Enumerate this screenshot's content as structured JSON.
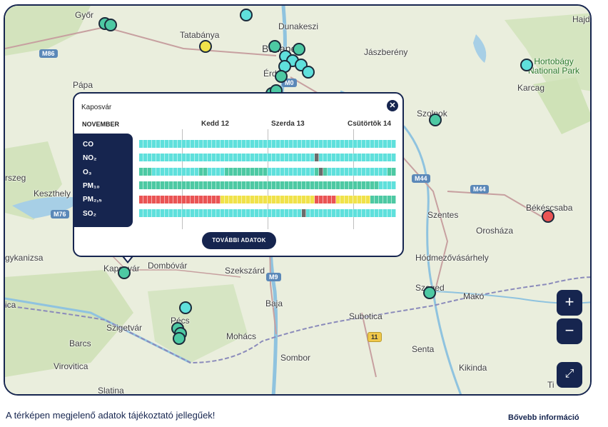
{
  "map": {
    "labels": {
      "gyor": "Győr",
      "tatabanya": "Tatabánya",
      "dunakeszi": "Dunakeszi",
      "budapest": "Budapest",
      "erd": "Érd",
      "jaszbereny": "Jászberény",
      "hajdu": "Hajdú",
      "hortobagy": "Hortobágy\nNational Park",
      "karcag": "Karcag",
      "papa": "Pápa",
      "szolnok": "Szolnok",
      "szeg": "rszeg",
      "keszthely": "Keszthely",
      "bekescsaba": "Békéscsaba",
      "szentes": "Szentes",
      "oroshaza": "Orosháza",
      "hodmezo": "Hódmezővásárhely",
      "kanizsa": "gykanizsa",
      "kaposvar": "Kaposvár",
      "dombovar": "Dombóvár",
      "szekszard": "Szekszárd",
      "szeged": "Szeged",
      "mako": "Makó",
      "baja": "Baja",
      "subotica": "Subotica",
      "pecs": "Pécs",
      "szigetvar": "Szigetvár",
      "mohacs": "Mohács",
      "barcs": "Barcs",
      "senta": "Senta",
      "kikinda": "Kikinda",
      "virovitica": "Virovitica",
      "sombor": "Sombor",
      "slatina": "Slatina",
      "ica": "ica",
      "ti": "Ti"
    },
    "roads": {
      "m86": "M86",
      "m0": "M0",
      "m44a": "M44",
      "m44b": "M44",
      "m76": "M76",
      "m9": "M9",
      "r11": "11"
    },
    "status_colors": {
      "good": "#4dc9a3",
      "excellent": "#5fe0dc",
      "moderate": "#f0e24a",
      "poor": "#ea5454"
    }
  },
  "popup": {
    "station": "Kaposvár",
    "month": "NOVEMBER",
    "days": [
      "Kedd 12",
      "Szerda 13",
      "Csütörtök 14"
    ],
    "pollutants": [
      {
        "name": "CO"
      },
      {
        "name": "NO₂"
      },
      {
        "name": "O₃"
      },
      {
        "name": "PM₁₀"
      },
      {
        "name": "PM₂,₅"
      },
      {
        "name": "SO₂"
      }
    ],
    "more_button": "TOVÁBBI ADATOK",
    "close_icon": "close-icon"
  },
  "controls": {
    "zoom_in": "+",
    "zoom_out": "−",
    "fullscreen_icon": "expand-icon"
  },
  "footer": {
    "note": "A térképen megjelenő adatok tájékoztató jellegűek!",
    "link": "Bővebb információ"
  }
}
